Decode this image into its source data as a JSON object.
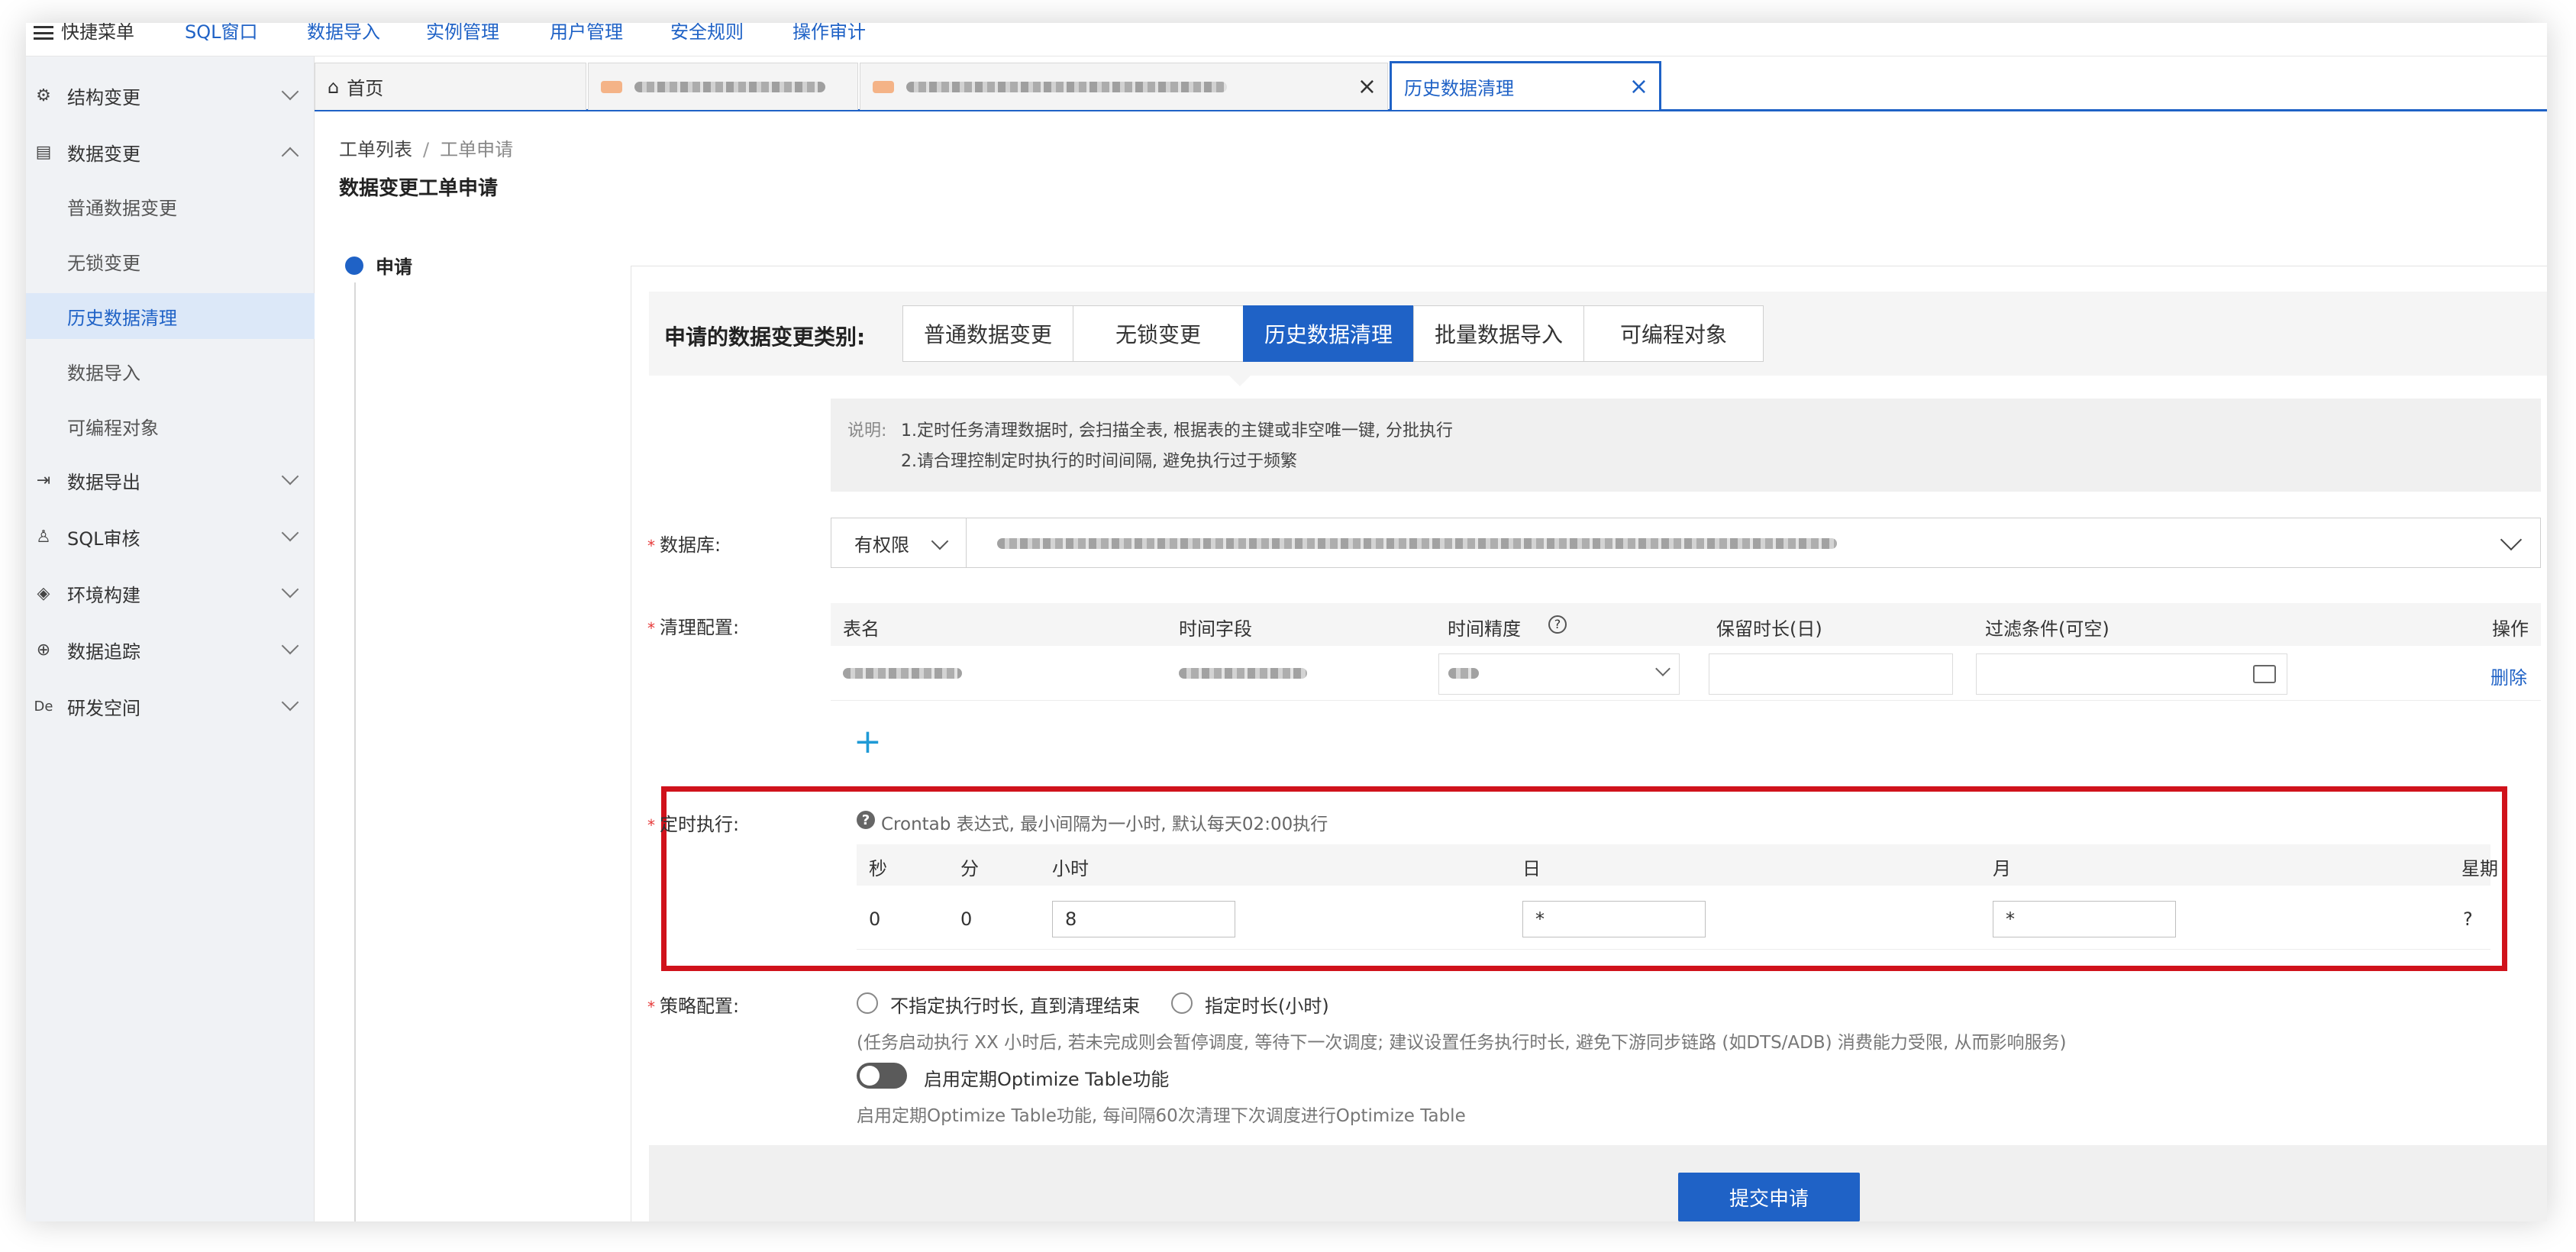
{
  "topnav": {
    "items": [
      "快捷菜单",
      "SQL窗口",
      "数据导入",
      "实例管理",
      "用户管理",
      "安全规则",
      "操作审计"
    ]
  },
  "sidebar": {
    "groups": [
      {
        "label": "结构变更",
        "icon": "structure-icon"
      },
      {
        "label": "数据变更",
        "icon": "data-change-icon"
      },
      {
        "label": "数据导出",
        "icon": "export-icon"
      },
      {
        "label": "SQL审核",
        "icon": "audit-icon"
      },
      {
        "label": "环境构建",
        "icon": "env-icon"
      },
      {
        "label": "数据追踪",
        "icon": "trace-icon"
      },
      {
        "label": "研发空间",
        "icon": "dev-space-icon"
      }
    ],
    "sub": [
      "普通数据变更",
      "无锁变更",
      "历史数据清理",
      "数据导入",
      "可编程对象"
    ],
    "dev_icon_text": "De"
  },
  "tabs": {
    "home": "首页",
    "active": "历史数据清理",
    "close": "×"
  },
  "breadcrumb": {
    "list": "工单列表",
    "sep": "/",
    "current": "工单申请"
  },
  "page_title": "数据变更工单申请",
  "step": {
    "label": "申请"
  },
  "type_select": {
    "label": "申请的数据变更类别:",
    "options": [
      "普通数据变更",
      "无锁变更",
      "历史数据清理",
      "批量数据导入",
      "可编程对象"
    ],
    "selected": "历史数据清理"
  },
  "note": {
    "head": "说明:",
    "line1": "1.定时任务清理数据时, 会扫描全表, 根据表的主键或非空唯一键, 分批执行",
    "line2": "2.请合理控制定时执行的时间间隔, 避免执行过于频繁"
  },
  "db": {
    "label": "数据库:",
    "permission": "有权限"
  },
  "clean": {
    "label": "清理配置:",
    "headers": [
      "表名",
      "时间字段",
      "时间精度",
      "保留时长(日)",
      "过滤条件(可空)",
      "操作"
    ],
    "delete": "删除",
    "add": "+"
  },
  "cron": {
    "label": "定时执行:",
    "tip": "Crontab 表达式, 最小间隔为一小时, 默认每天02:00执行",
    "headers": [
      "秒",
      "分",
      "小时",
      "日",
      "月",
      "星期"
    ],
    "values": {
      "sec": "0",
      "min": "0",
      "hour": "8",
      "day": "*",
      "month": "*",
      "week": "?"
    }
  },
  "strategy": {
    "label": "策略配置:",
    "opt1": "不指定执行时长, 直到清理结束",
    "opt2": "指定时长(小时)",
    "hint": "(任务启动执行 XX 小时后, 若未完成则会暂停调度, 等待下一次调度; 建议设置任务执行时长, 避免下游同步链路 (如DTS/ADB) 消费能力受限, 从而影响服务)",
    "toggle_label": "启用定期Optimize Table功能",
    "toggle_hint": "启用定期Optimize Table功能, 每间隔60次清理下次调度进行Optimize Table",
    "toggle_on": false
  },
  "submit": "提交申请"
}
